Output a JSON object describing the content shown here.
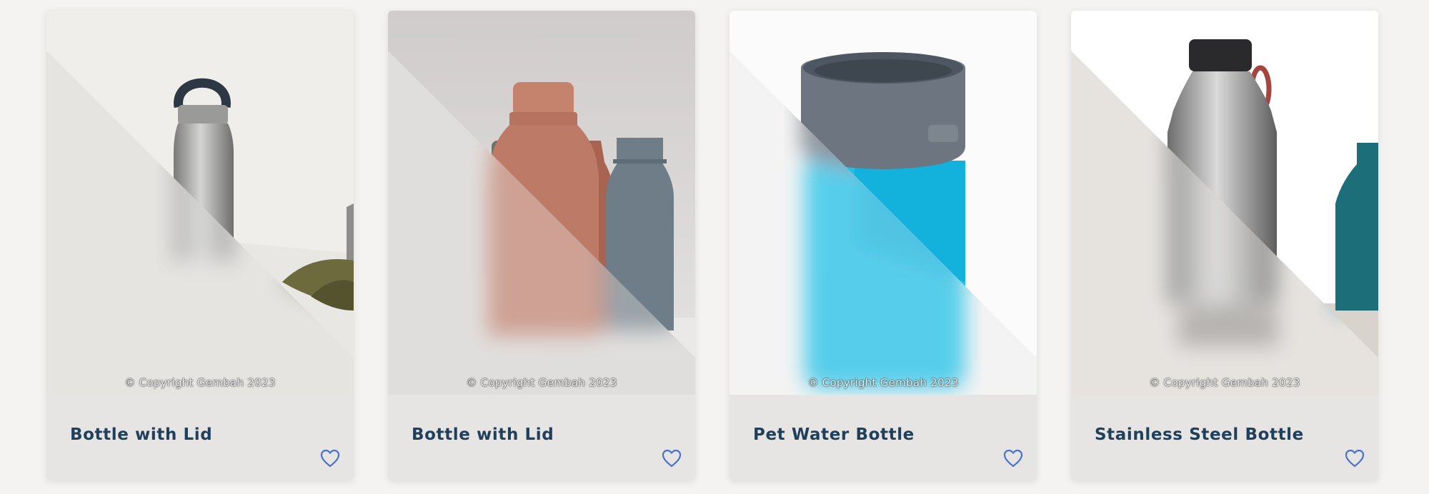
{
  "products": [
    {
      "title": "Bottle with Lid",
      "copyright": "© Copyright Gembah 2023",
      "favorite_icon": "heart-outline-icon",
      "accent": "#4a72c8"
    },
    {
      "title": "Bottle with Lid",
      "copyright": "© Copyright Gembah 2023",
      "favorite_icon": "heart-outline-icon",
      "accent": "#4a72c8"
    },
    {
      "title": "Pet Water Bottle",
      "copyright": "© Copyright Gembah 2023",
      "favorite_icon": "heart-outline-icon",
      "accent": "#4a72c8"
    },
    {
      "title": "Stainless Steel Bottle",
      "copyright": "© Copyright Gembah 2023",
      "favorite_icon": "heart-outline-icon",
      "accent": "#4a72c8"
    }
  ]
}
